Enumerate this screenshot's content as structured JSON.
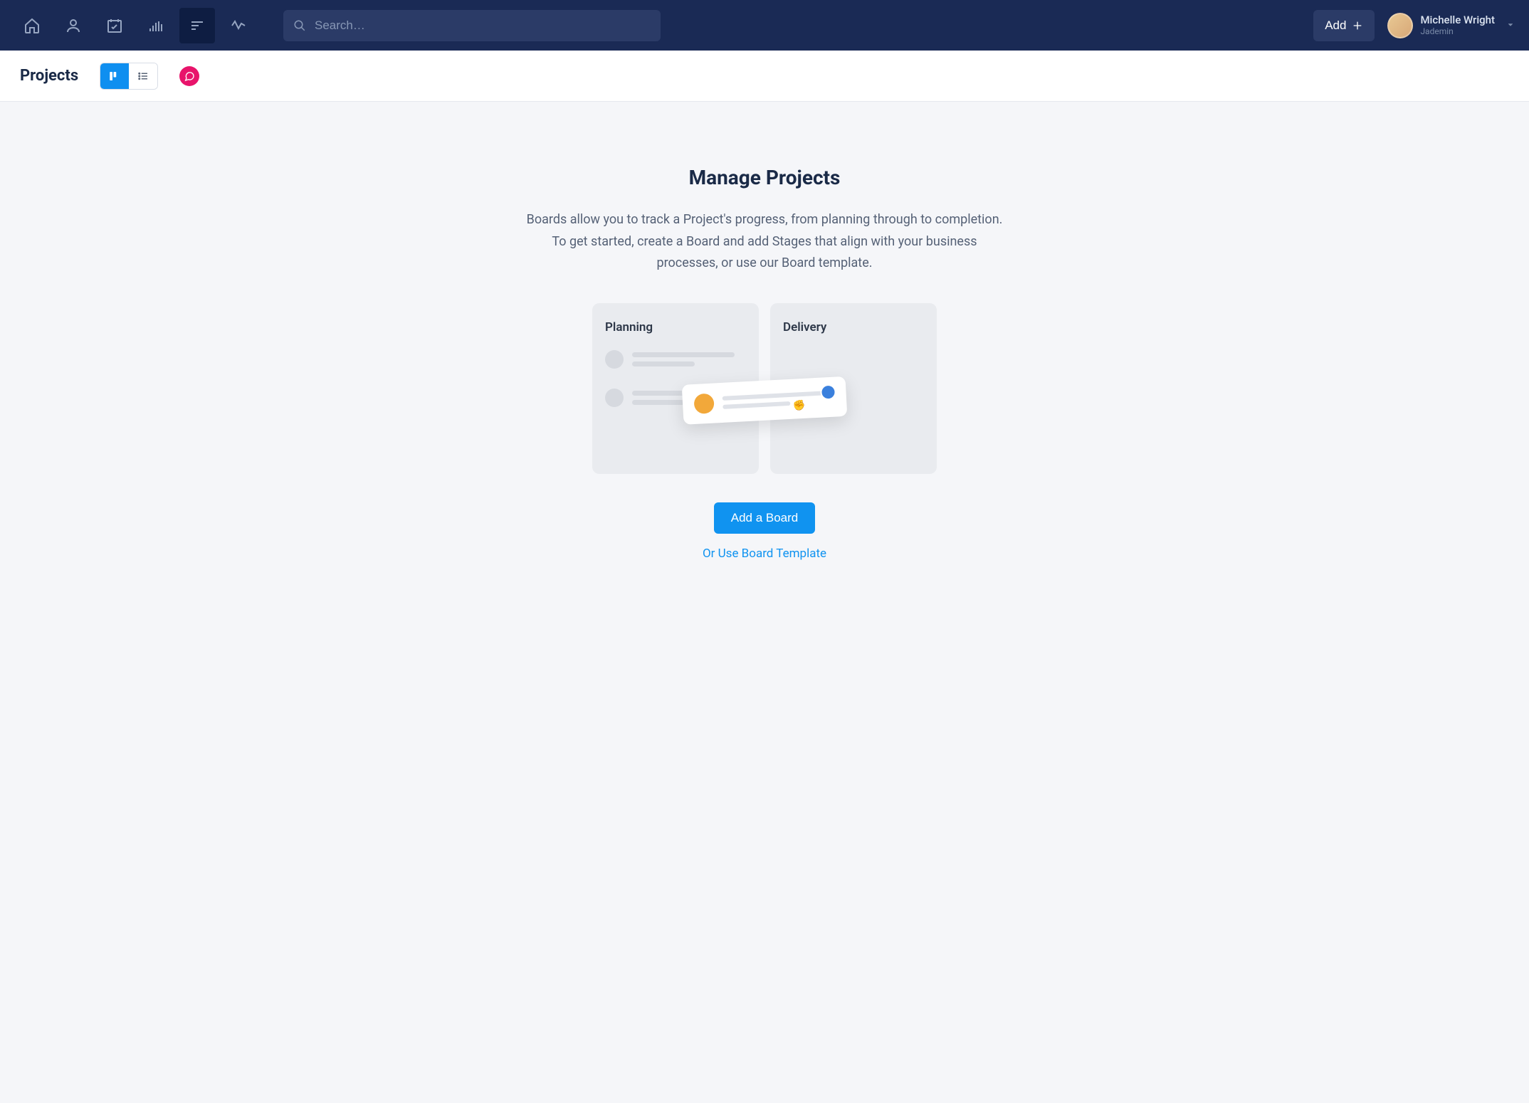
{
  "topnav": {
    "search_placeholder": "Search…",
    "add_label": "Add"
  },
  "user": {
    "name": "Michelle Wright",
    "sub": "Jademin"
  },
  "subheader": {
    "title": "Projects"
  },
  "main": {
    "title": "Manage Projects",
    "description": "Boards allow you to track a Project's progress, from planning through to completion. To get started, create a Board and add Stages that align with your business processes, or use our Board template.",
    "illustration_cols": [
      "Planning",
      "Delivery"
    ],
    "primary_button": "Add a Board",
    "link": "Or Use Board Template"
  }
}
